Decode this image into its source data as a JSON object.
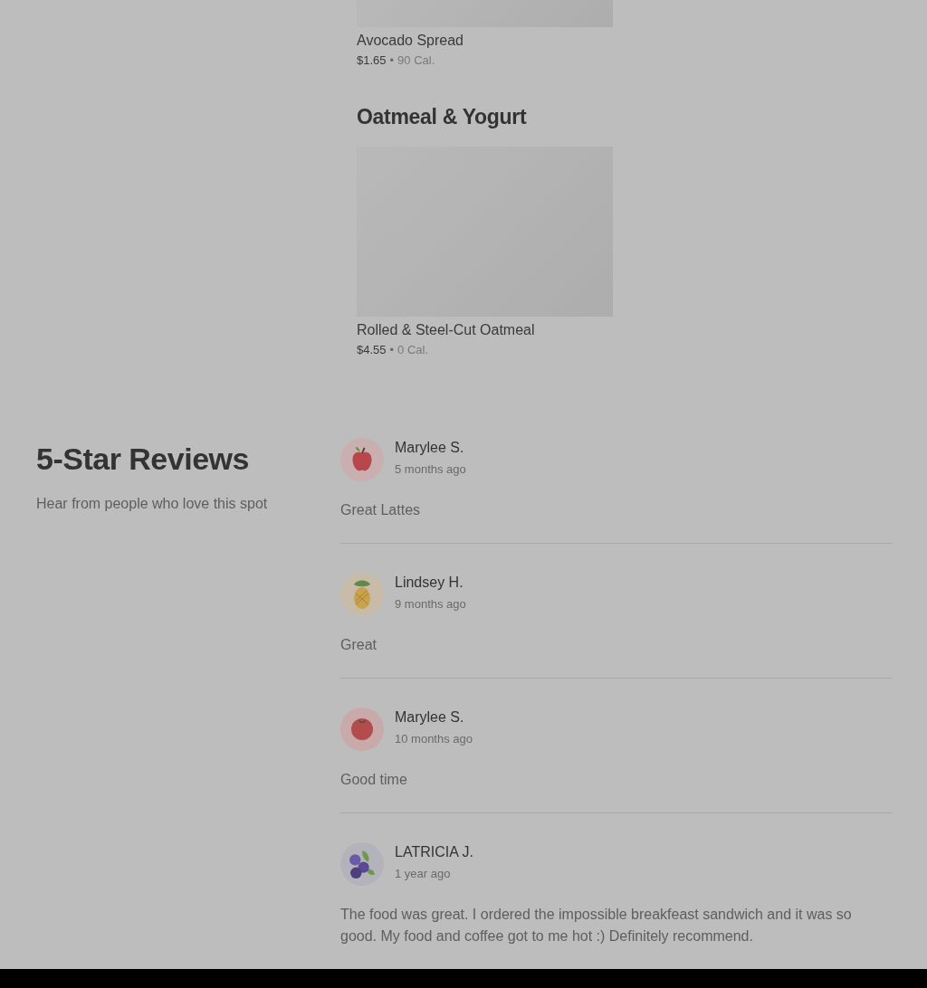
{
  "menu": {
    "items": [
      {
        "name": "Avocado Spread",
        "price": "$1.65",
        "separator": "•",
        "calories": "90 Cal."
      }
    ],
    "sections": [
      {
        "title": "Oatmeal & Yogurt",
        "items": [
          {
            "name": "Rolled & Steel-Cut Oatmeal",
            "price": "$4.55",
            "separator": "•",
            "calories": "0 Cal."
          }
        ]
      }
    ]
  },
  "reviews": {
    "title": "5-Star Reviews",
    "subtitle": "Hear from people who love this spot",
    "items": [
      {
        "name": "Marylee S.",
        "time": "5 months ago",
        "text": "Great Lattes",
        "kind": "apple"
      },
      {
        "name": "Lindsey H.",
        "time": "9 months ago",
        "text": "Great",
        "kind": "pineapple"
      },
      {
        "name": "Marylee S.",
        "time": "10 months ago",
        "text": "Good time",
        "kind": "tomato"
      },
      {
        "name": "LATRICIA J.",
        "time": "1 year ago",
        "text": "The food was great. I ordered the impossible breakfeast sandwich and it was so good. My food and coffee got to me hot :) Definitely recommend.",
        "kind": "blueberry"
      }
    ]
  }
}
